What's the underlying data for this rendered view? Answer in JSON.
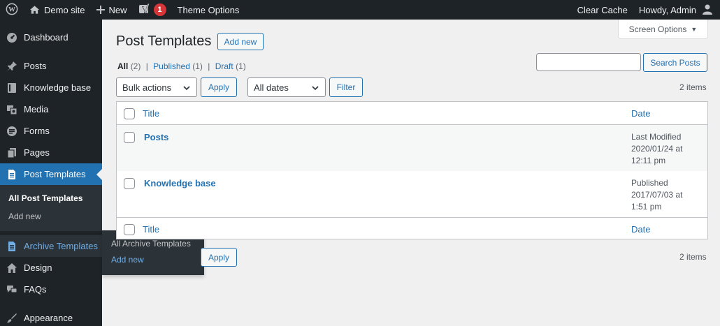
{
  "adminbar": {
    "site_name": "Demo site",
    "new_label": "New",
    "notification_count": "1",
    "theme_options": "Theme Options",
    "clear_cache": "Clear Cache",
    "howdy": "Howdy, Admin"
  },
  "sidebar": {
    "items": [
      {
        "label": "Dashboard",
        "icon": "dashboard-icon"
      },
      {
        "label": "Posts",
        "icon": "pin-icon"
      },
      {
        "label": "Knowledge base",
        "icon": "book-icon"
      },
      {
        "label": "Media",
        "icon": "media-icon"
      },
      {
        "label": "Forms",
        "icon": "forms-icon"
      },
      {
        "label": "Pages",
        "icon": "pages-icon"
      },
      {
        "label": "Post Templates",
        "icon": "document-icon"
      },
      {
        "label": "Archive Templates",
        "icon": "document-icon"
      },
      {
        "label": "Design",
        "icon": "home-icon"
      },
      {
        "label": "FAQs",
        "icon": "chat-icon"
      },
      {
        "label": "Appearance",
        "icon": "brush-icon"
      }
    ],
    "submenu": [
      "All Post Templates",
      "Add new"
    ]
  },
  "flyout": {
    "items": [
      "All Archive Templates",
      "Add new"
    ]
  },
  "header": {
    "title": "Post Templates",
    "add_new": "Add new",
    "screen_options": "Screen Options"
  },
  "filters": {
    "all": "All",
    "all_count": "(2)",
    "published": "Published",
    "published_count": "(1)",
    "draft": "Draft",
    "draft_count": "(1)",
    "separator": "|"
  },
  "search": {
    "button": "Search Posts",
    "value": ""
  },
  "toolbar": {
    "bulk_actions": "Bulk actions",
    "apply": "Apply",
    "all_dates": "All dates",
    "filter": "Filter",
    "items_count": "2 items"
  },
  "table": {
    "columns": {
      "title": "Title",
      "date": "Date"
    },
    "rows": [
      {
        "title": "Posts",
        "status": "Last Modified",
        "date": "2020/01/24 at",
        "time": "12:11 pm"
      },
      {
        "title": "Knowledge base",
        "status": "Published",
        "date": "2017/07/03 at",
        "time": "1:51 pm"
      }
    ]
  },
  "bottom_toolbar": {
    "apply": "Apply",
    "items_count": "2 items"
  }
}
